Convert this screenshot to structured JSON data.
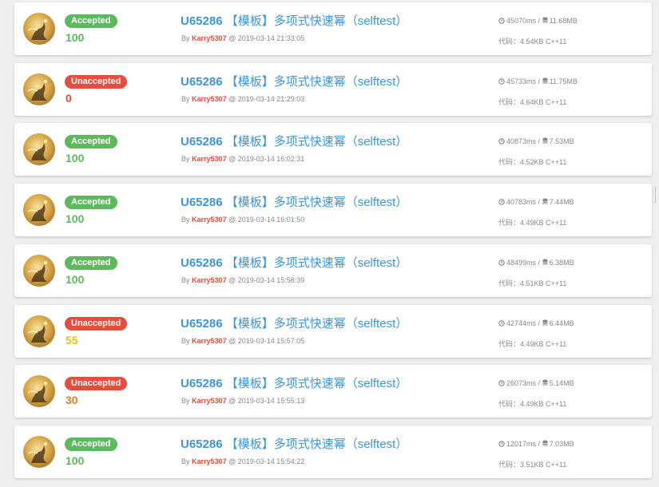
{
  "colors": {
    "accepted": "#5eb95e",
    "unaccepted": "#e74c3c",
    "score_full": "#5eb95e",
    "score_zero": "#e74c3c",
    "score_mid_yellow": "#e2c217",
    "score_mid_orange": "#e67e22",
    "link": "#3e95d2"
  },
  "records": [
    {
      "status": "Accepted",
      "score": "100",
      "pid": "U65286",
      "title": "【模板】多项式快速幂（selftest）",
      "by": "By",
      "user": "Karry5307",
      "time": "@ 2019-03-14 21:33:05",
      "runtime": "45070ms",
      "memory": "11.68MB",
      "code_label": "代码：",
      "code": "4.54KB C++11"
    },
    {
      "status": "Unaccepted",
      "score": "0",
      "pid": "U65286",
      "title": "【模板】多项式快速幂（selftest）",
      "by": "By",
      "user": "Karry5307",
      "time": "@ 2019-03-14 21:29:03",
      "runtime": "45733ms",
      "memory": "11.75MB",
      "code_label": "代码：",
      "code": "4.64KB C++11"
    },
    {
      "status": "Accepted",
      "score": "100",
      "pid": "U65286",
      "title": "【模板】多项式快速幂（selftest）",
      "by": "By",
      "user": "Karry5307",
      "time": "@ 2019-03-14 16:02:31",
      "runtime": "40873ms",
      "memory": "7.53MB",
      "code_label": "代码：",
      "code": "4.52KB C++11"
    },
    {
      "status": "Accepted",
      "score": "100",
      "pid": "U65286",
      "title": "【模板】多项式快速幂（selftest）",
      "by": "By",
      "user": "Karry5307",
      "time": "@ 2019-03-14 16:01:50",
      "runtime": "40783ms",
      "memory": "7.44MB",
      "code_label": "代码：",
      "code": "4.49KB C++11"
    },
    {
      "status": "Accepted",
      "score": "100",
      "pid": "U65286",
      "title": "【模板】多项式快速幂（selftest）",
      "by": "By",
      "user": "Karry5307",
      "time": "@ 2019-03-14 15:58:39",
      "runtime": "48499ms",
      "memory": "6.38MB",
      "code_label": "代码：",
      "code": "4.51KB C++11"
    },
    {
      "status": "Unaccepted",
      "score": "55",
      "pid": "U65286",
      "title": "【模板】多项式快速幂（selftest）",
      "by": "By",
      "user": "Karry5307",
      "time": "@ 2019-03-14 15:57:05",
      "runtime": "42744ms",
      "memory": "6.44MB",
      "code_label": "代码：",
      "code": "4.49KB C++11"
    },
    {
      "status": "Unaccepted",
      "score": "30",
      "pid": "U65286",
      "title": "【模板】多项式快速幂（selftest）",
      "by": "By",
      "user": "Karry5307",
      "time": "@ 2019-03-14 15:55:13",
      "runtime": "26073ms",
      "memory": "5.14MB",
      "code_label": "代码：",
      "code": "4.49KB C++11"
    },
    {
      "status": "Accepted",
      "score": "100",
      "pid": "U65286",
      "title": "【模板】多项式快速幂（selftest）",
      "by": "By",
      "user": "Karry5307",
      "time": "@ 2019-03-14 15:54:22",
      "runtime": "12017ms",
      "memory": "7.03MB",
      "code_label": "代码：",
      "code": "3.51KB C++11"
    }
  ],
  "icons": {
    "runtime": "clock-icon",
    "memory": "database-icon",
    "avatar": "user-avatar"
  }
}
